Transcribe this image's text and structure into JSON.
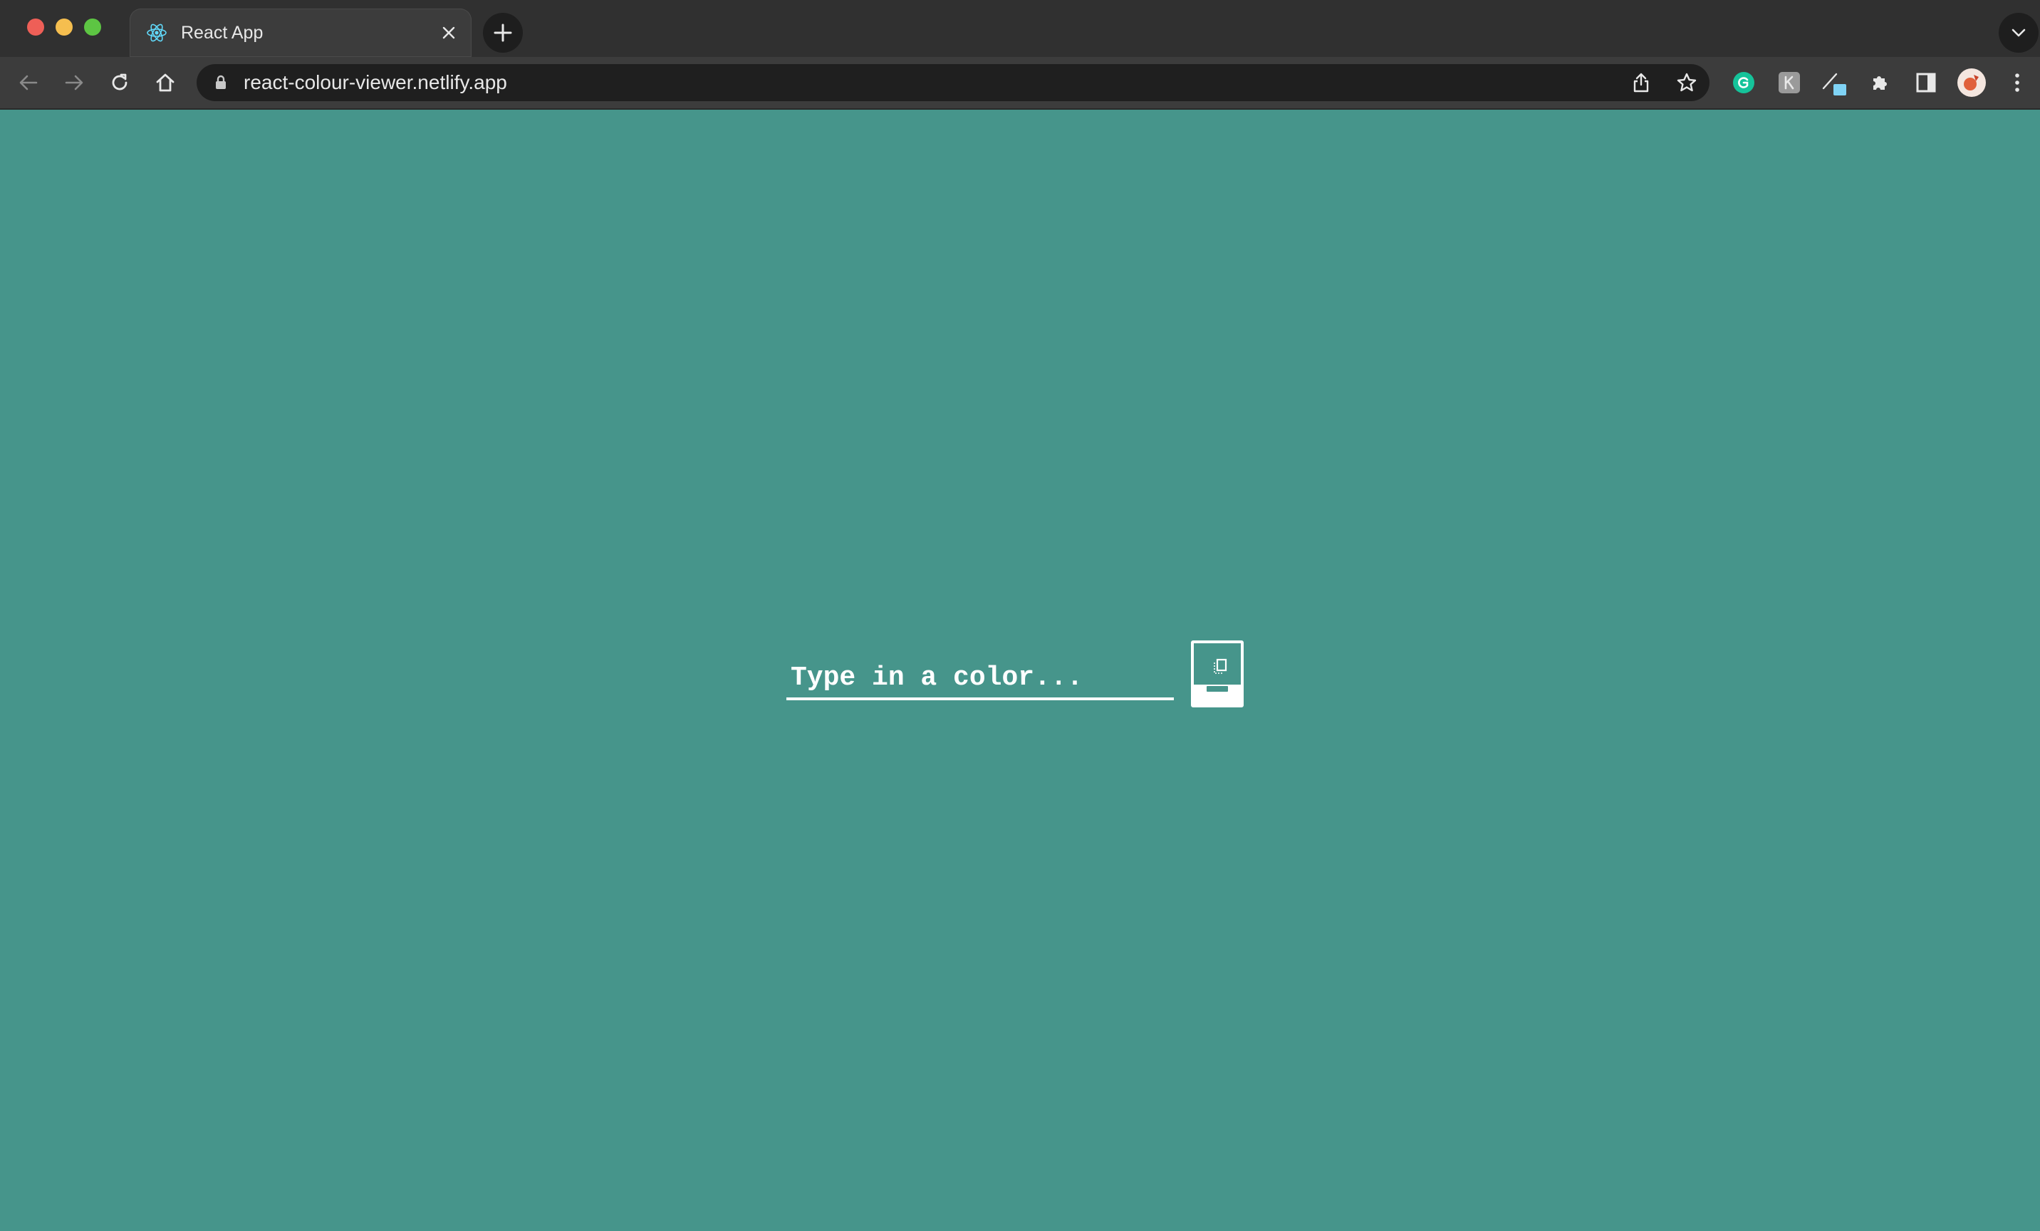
{
  "browser": {
    "tab": {
      "title": "React App",
      "favicon": "react-icon"
    },
    "address_bar": {
      "url": "react-colour-viewer.netlify.app"
    },
    "colors": {
      "tabstrip_bg": "#303030",
      "toolbar_bg": "#3c3c3c",
      "omnibox_bg": "#1f1f1f"
    },
    "toolbar_icons": [
      "back-arrow-icon",
      "forward-arrow-icon",
      "reload-icon",
      "home-icon",
      "lock-icon",
      "share-icon",
      "star-icon",
      "grammarly-icon",
      "extension-k-icon",
      "color-picker-icon",
      "puzzle-icon",
      "side-panel-icon",
      "profile-avatar",
      "more-vert-icon"
    ]
  },
  "page": {
    "background_color": "#46958b",
    "color_input": {
      "placeholder": "Type in a color...",
      "value": ""
    },
    "copy_button": {
      "icon": "copy-icon"
    }
  }
}
